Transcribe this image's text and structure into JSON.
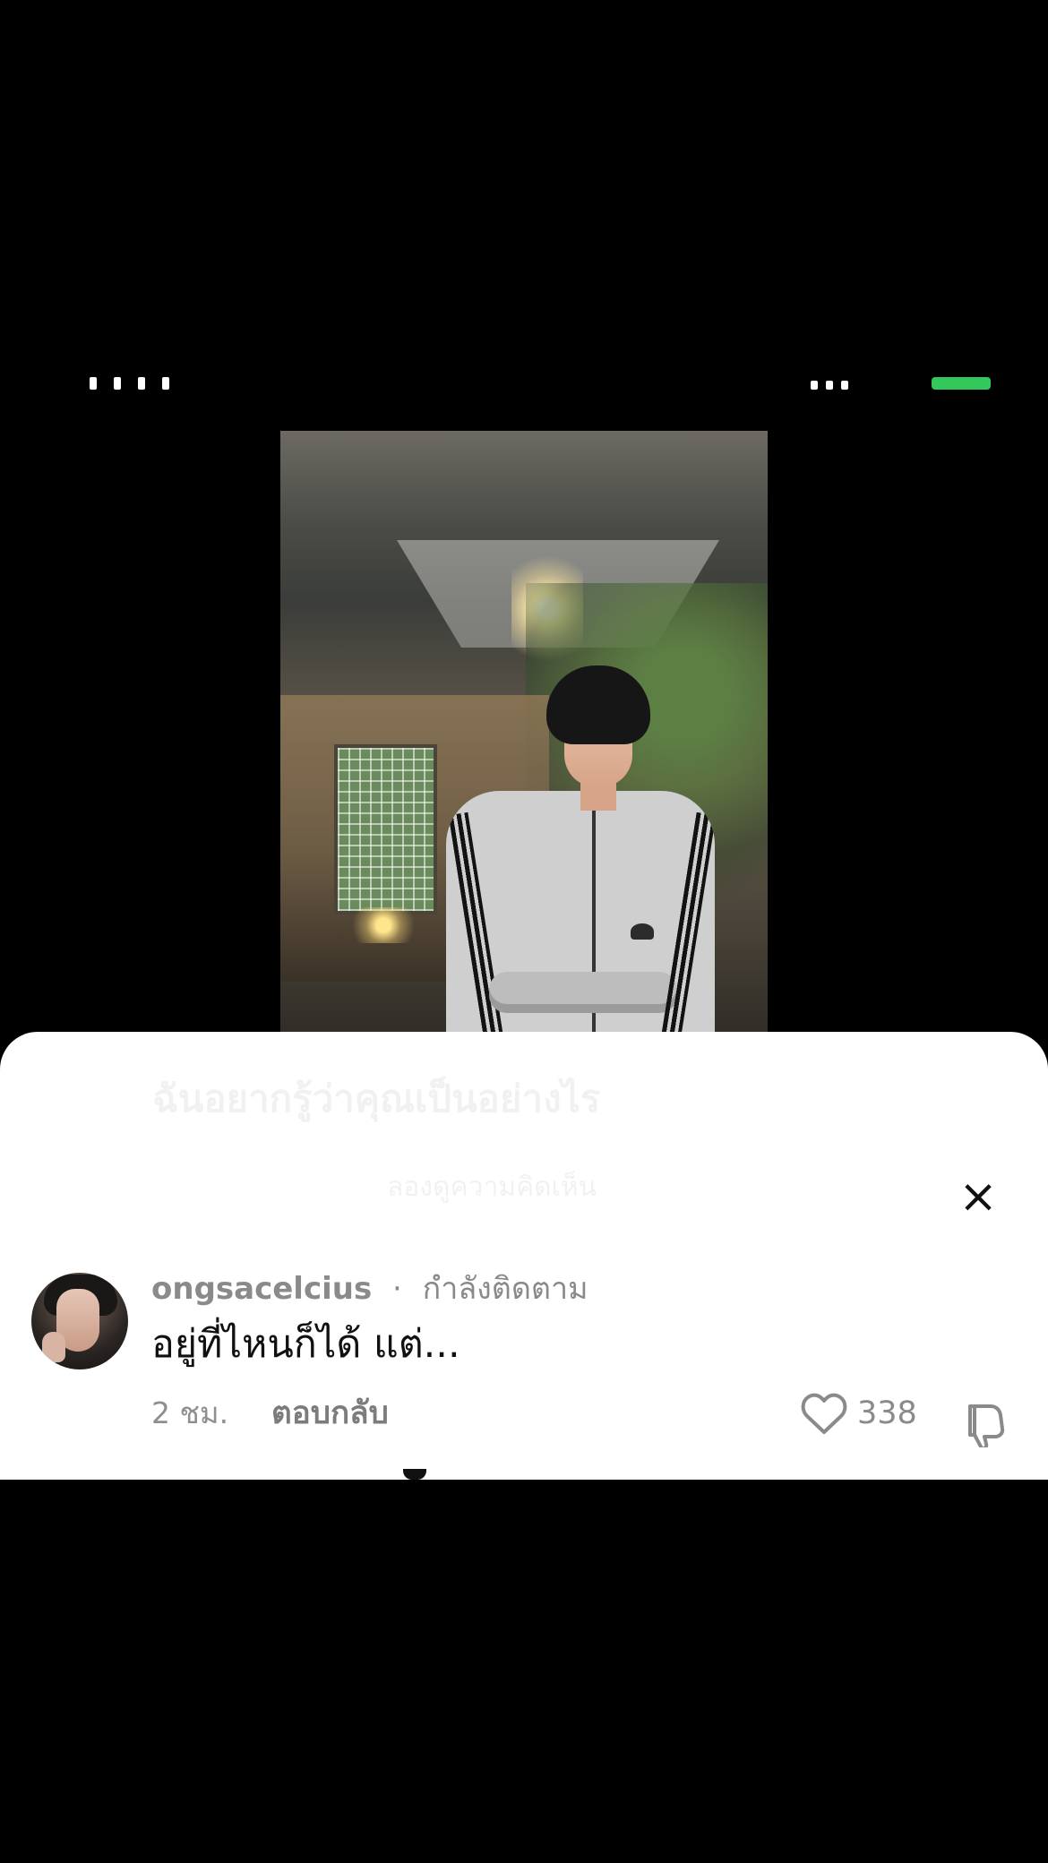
{
  "comment": {
    "username": "ongsacelcius",
    "separator": "·",
    "follow_status": "กำลังติดตาม",
    "text": "อยู่ที่ไหนก็ได้ แต่...",
    "time_ago": "2 ชม.",
    "reply_label": "ตอบกลับ",
    "like_count": "338"
  },
  "icons": {
    "close": "close-icon",
    "like": "heart-icon",
    "dislike": "thumb-down-icon",
    "avatar": "avatar"
  },
  "colors": {
    "background": "#000000",
    "sheet": "#ffffff",
    "meta_text": "#8a8a8a",
    "body_text": "#111111",
    "battery": "#34c759"
  }
}
